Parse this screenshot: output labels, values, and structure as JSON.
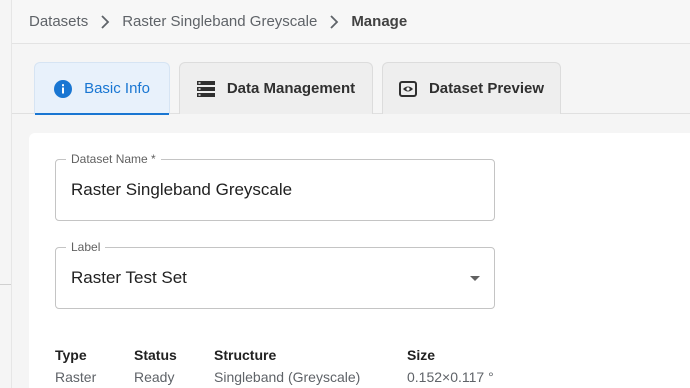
{
  "breadcrumb": {
    "items": [
      "Datasets",
      "Raster Singleband Greyscale"
    ],
    "current": "Manage"
  },
  "tabs": [
    {
      "label": "Basic Info",
      "icon": "info-icon",
      "active": true
    },
    {
      "label": "Data Management",
      "icon": "list-icon",
      "active": false
    },
    {
      "label": "Dataset Preview",
      "icon": "eye-icon",
      "active": false
    }
  ],
  "form": {
    "dataset_name": {
      "legend": "Dataset Name *",
      "value": "Raster Singleband Greyscale"
    },
    "label": {
      "legend": "Label",
      "value": "Raster Test Set"
    }
  },
  "meta": {
    "type": {
      "header": "Type",
      "value": "Raster"
    },
    "status": {
      "header": "Status",
      "value": "Ready"
    },
    "structure": {
      "header": "Structure",
      "value": "Singleband (Greyscale)"
    },
    "size": {
      "header": "Size",
      "value": "0.152×0.117 °"
    }
  },
  "colors": {
    "accent": "#1976d2",
    "active_tab_bg": "#e8f1fb",
    "tab_bg": "#eeeeee"
  }
}
